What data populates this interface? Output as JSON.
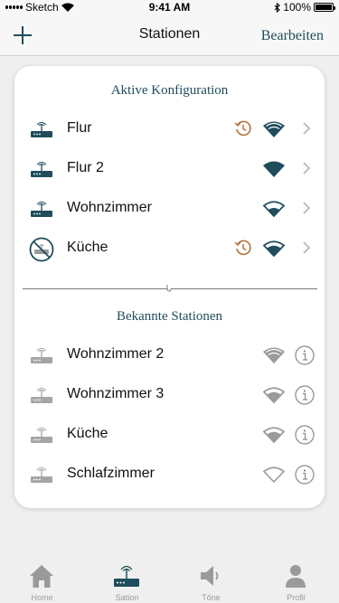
{
  "status_bar": {
    "carrier": "Sketch",
    "time": "9:41 AM",
    "battery": "100%"
  },
  "nav": {
    "title": "Stationen",
    "edit_label": "Bearbeiten"
  },
  "active": {
    "title": "Aktive Konfiguration",
    "rows": [
      {
        "name": "Flur"
      },
      {
        "name": "Flur 2"
      },
      {
        "name": "Wohnzimmer"
      },
      {
        "name": "Küche"
      }
    ]
  },
  "known": {
    "title": "Bekannte Stationen",
    "rows": [
      {
        "name": "Wohnzimmer 2"
      },
      {
        "name": "Wohnzimmer 3"
      },
      {
        "name": "Küche"
      },
      {
        "name": "Schlafzimmer"
      }
    ]
  },
  "tabs": [
    {
      "label": "Home"
    },
    {
      "label": "Sation"
    },
    {
      "label": "Töne"
    },
    {
      "label": "Profil"
    }
  ],
  "colors": {
    "accent": "#1f4d5c",
    "clock": "#b0733a",
    "inactive": "#9a9a9a"
  }
}
